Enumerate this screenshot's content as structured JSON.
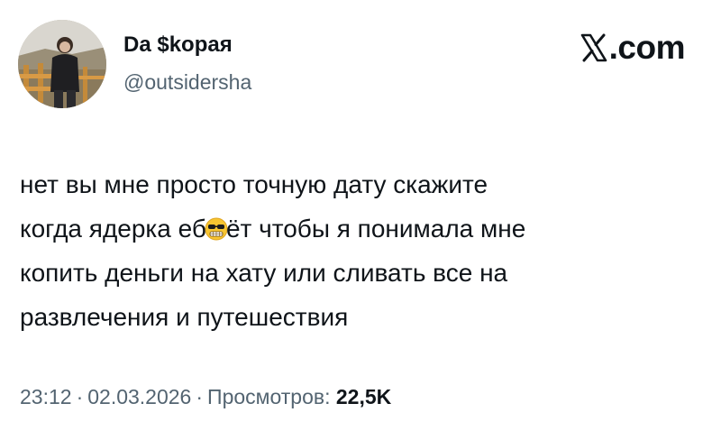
{
  "author": {
    "display_name": "Da $kopaя",
    "handle": "@outsidersha",
    "avatar_icon": "profile-photo"
  },
  "brand": {
    "logo_icon": "x-logo-icon",
    "text": ".com"
  },
  "tweet": {
    "lines": [
      "нет вы мне просто точную дату скажите",
      "когда ядерка еб",
      "ёт чтобы я понимала мне",
      "копить деньги на хату или сливать все на",
      "развлечения и путешествия"
    ],
    "emoji_icon": "grimacing-sunglasses-emoji-icon"
  },
  "meta": {
    "time": "23:12",
    "separator": "·",
    "date": "02.03.2026",
    "views_label": "Просмотров:",
    "views_count": "22,5K"
  },
  "colors": {
    "text": "#0f1419",
    "secondary": "#536471",
    "background": "#ffffff"
  }
}
